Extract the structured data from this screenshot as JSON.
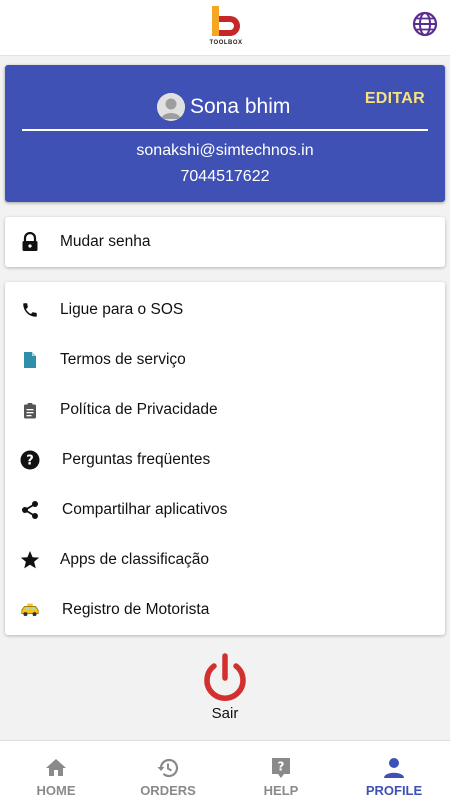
{
  "header": {
    "logo_text": "TOOLBOX",
    "logo_icon": "toolbox-logo",
    "language_icon": "globe-icon"
  },
  "profile": {
    "name": "Sona bhim",
    "edit_label": "EDITAR",
    "email": "sonakshi@simtechnos.in",
    "phone": "7044517622"
  },
  "account_menu": [
    {
      "label": "Mudar senha",
      "icon": "lock-icon"
    }
  ],
  "info_menu": [
    {
      "label": "Ligue para o SOS",
      "icon": "phone-icon"
    },
    {
      "label": "Termos de serviço",
      "icon": "document-icon"
    },
    {
      "label": "Política de Privacidade",
      "icon": "clipboard-icon"
    },
    {
      "label": "Perguntas freqüentes",
      "icon": "help-circle-icon"
    },
    {
      "label": "Compartilhar aplicativos",
      "icon": "share-icon"
    },
    {
      "label": "Apps de classificação",
      "icon": "star-icon"
    },
    {
      "label": "Registro de Motorista",
      "icon": "taxi-icon"
    }
  ],
  "logout": {
    "label": "Sair",
    "icon": "power-icon",
    "color": "#d32f2f"
  },
  "bottom_nav": {
    "tabs": [
      {
        "label": "HOME",
        "icon": "home-icon"
      },
      {
        "label": "ORDERS",
        "icon": "history-icon"
      },
      {
        "label": "HELP",
        "icon": "help-box-icon"
      },
      {
        "label": "PROFILE",
        "icon": "person-icon"
      }
    ],
    "active": "PROFILE"
  },
  "colors": {
    "primary": "#3f51b5",
    "edit_accent": "#f7e27b",
    "inactive_tab": "#8a8a8a",
    "background": "#f2f2f2"
  }
}
